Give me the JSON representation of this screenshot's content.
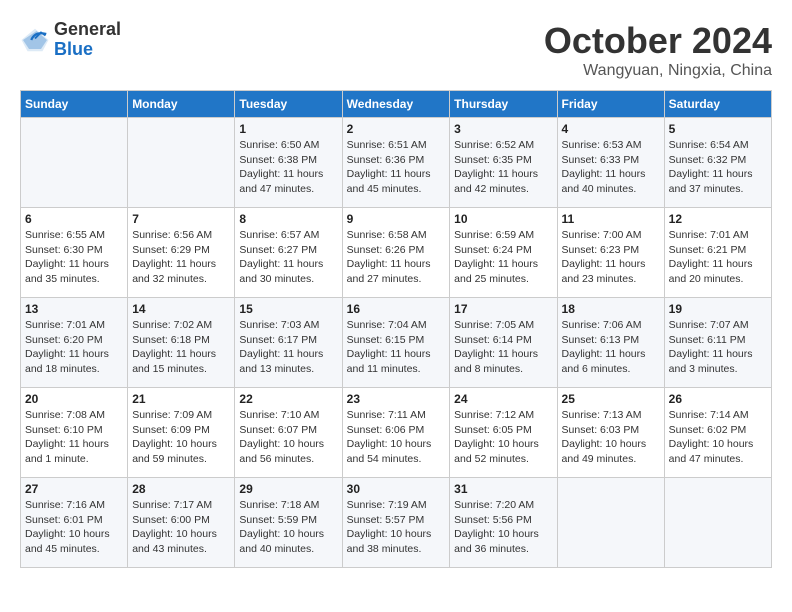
{
  "header": {
    "logo": {
      "general": "General",
      "blue": "Blue"
    },
    "title": "October 2024",
    "subtitle": "Wangyuan, Ningxia, China"
  },
  "days_of_week": [
    "Sunday",
    "Monday",
    "Tuesday",
    "Wednesday",
    "Thursday",
    "Friday",
    "Saturday"
  ],
  "weeks": [
    [
      {
        "day": "",
        "info": ""
      },
      {
        "day": "",
        "info": ""
      },
      {
        "day": "1",
        "info": "Sunrise: 6:50 AM\nSunset: 6:38 PM\nDaylight: 11 hours and 47 minutes."
      },
      {
        "day": "2",
        "info": "Sunrise: 6:51 AM\nSunset: 6:36 PM\nDaylight: 11 hours and 45 minutes."
      },
      {
        "day": "3",
        "info": "Sunrise: 6:52 AM\nSunset: 6:35 PM\nDaylight: 11 hours and 42 minutes."
      },
      {
        "day": "4",
        "info": "Sunrise: 6:53 AM\nSunset: 6:33 PM\nDaylight: 11 hours and 40 minutes."
      },
      {
        "day": "5",
        "info": "Sunrise: 6:54 AM\nSunset: 6:32 PM\nDaylight: 11 hours and 37 minutes."
      }
    ],
    [
      {
        "day": "6",
        "info": "Sunrise: 6:55 AM\nSunset: 6:30 PM\nDaylight: 11 hours and 35 minutes."
      },
      {
        "day": "7",
        "info": "Sunrise: 6:56 AM\nSunset: 6:29 PM\nDaylight: 11 hours and 32 minutes."
      },
      {
        "day": "8",
        "info": "Sunrise: 6:57 AM\nSunset: 6:27 PM\nDaylight: 11 hours and 30 minutes."
      },
      {
        "day": "9",
        "info": "Sunrise: 6:58 AM\nSunset: 6:26 PM\nDaylight: 11 hours and 27 minutes."
      },
      {
        "day": "10",
        "info": "Sunrise: 6:59 AM\nSunset: 6:24 PM\nDaylight: 11 hours and 25 minutes."
      },
      {
        "day": "11",
        "info": "Sunrise: 7:00 AM\nSunset: 6:23 PM\nDaylight: 11 hours and 23 minutes."
      },
      {
        "day": "12",
        "info": "Sunrise: 7:01 AM\nSunset: 6:21 PM\nDaylight: 11 hours and 20 minutes."
      }
    ],
    [
      {
        "day": "13",
        "info": "Sunrise: 7:01 AM\nSunset: 6:20 PM\nDaylight: 11 hours and 18 minutes."
      },
      {
        "day": "14",
        "info": "Sunrise: 7:02 AM\nSunset: 6:18 PM\nDaylight: 11 hours and 15 minutes."
      },
      {
        "day": "15",
        "info": "Sunrise: 7:03 AM\nSunset: 6:17 PM\nDaylight: 11 hours and 13 minutes."
      },
      {
        "day": "16",
        "info": "Sunrise: 7:04 AM\nSunset: 6:15 PM\nDaylight: 11 hours and 11 minutes."
      },
      {
        "day": "17",
        "info": "Sunrise: 7:05 AM\nSunset: 6:14 PM\nDaylight: 11 hours and 8 minutes."
      },
      {
        "day": "18",
        "info": "Sunrise: 7:06 AM\nSunset: 6:13 PM\nDaylight: 11 hours and 6 minutes."
      },
      {
        "day": "19",
        "info": "Sunrise: 7:07 AM\nSunset: 6:11 PM\nDaylight: 11 hours and 3 minutes."
      }
    ],
    [
      {
        "day": "20",
        "info": "Sunrise: 7:08 AM\nSunset: 6:10 PM\nDaylight: 11 hours and 1 minute."
      },
      {
        "day": "21",
        "info": "Sunrise: 7:09 AM\nSunset: 6:09 PM\nDaylight: 10 hours and 59 minutes."
      },
      {
        "day": "22",
        "info": "Sunrise: 7:10 AM\nSunset: 6:07 PM\nDaylight: 10 hours and 56 minutes."
      },
      {
        "day": "23",
        "info": "Sunrise: 7:11 AM\nSunset: 6:06 PM\nDaylight: 10 hours and 54 minutes."
      },
      {
        "day": "24",
        "info": "Sunrise: 7:12 AM\nSunset: 6:05 PM\nDaylight: 10 hours and 52 minutes."
      },
      {
        "day": "25",
        "info": "Sunrise: 7:13 AM\nSunset: 6:03 PM\nDaylight: 10 hours and 49 minutes."
      },
      {
        "day": "26",
        "info": "Sunrise: 7:14 AM\nSunset: 6:02 PM\nDaylight: 10 hours and 47 minutes."
      }
    ],
    [
      {
        "day": "27",
        "info": "Sunrise: 7:16 AM\nSunset: 6:01 PM\nDaylight: 10 hours and 45 minutes."
      },
      {
        "day": "28",
        "info": "Sunrise: 7:17 AM\nSunset: 6:00 PM\nDaylight: 10 hours and 43 minutes."
      },
      {
        "day": "29",
        "info": "Sunrise: 7:18 AM\nSunset: 5:59 PM\nDaylight: 10 hours and 40 minutes."
      },
      {
        "day": "30",
        "info": "Sunrise: 7:19 AM\nSunset: 5:57 PM\nDaylight: 10 hours and 38 minutes."
      },
      {
        "day": "31",
        "info": "Sunrise: 7:20 AM\nSunset: 5:56 PM\nDaylight: 10 hours and 36 minutes."
      },
      {
        "day": "",
        "info": ""
      },
      {
        "day": "",
        "info": ""
      }
    ]
  ]
}
